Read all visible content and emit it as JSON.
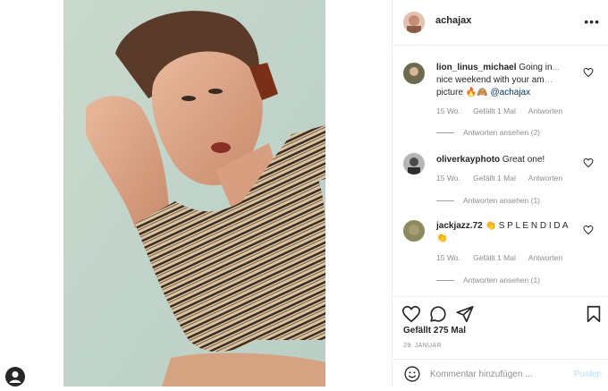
{
  "post": {
    "username": "achajax",
    "likes": "Gefällt 275 Mal",
    "date": "29. JANUAR"
  },
  "comments": [
    {
      "username": "lion_linus_michael",
      "text_a": "Going in",
      "text_b": "nice weekend with your am",
      "text_c": "picture",
      "emojis": "🔥🙈",
      "mention": "@achajax",
      "age": "15 Wo.",
      "likes": "Gefällt 1 Mal",
      "reply": "Antworten",
      "view_replies": "Antworten ansehen (2)"
    },
    {
      "username": "oliverkayphoto",
      "text": "Great one!",
      "age": "15 Wo.",
      "likes": "Gefällt 1 Mal",
      "reply": "Antworten",
      "view_replies": "Antworten ansehen (1)"
    },
    {
      "username": "jackjazz.72",
      "text": "👏 S P L E N D I D A 👏",
      "age": "15 Wo.",
      "likes": "Gefällt 1 Mal",
      "reply": "Antworten",
      "view_replies": "Antworten ansehen (1)"
    }
  ],
  "add_comment": {
    "placeholder": "Kommentar hinzufügen ...",
    "post_label": "Posten"
  },
  "icons": {
    "more": "more-icon",
    "like": "heart-icon",
    "comment": "comment-icon",
    "share": "share-icon",
    "save": "bookmark-icon",
    "emoji": "smiley-icon",
    "profile": "user-icon"
  },
  "colors": {
    "text": "#262626",
    "muted": "#8e8e8e",
    "link": "#00376b",
    "post_button": "#b2dffc",
    "divider": "#efefef"
  }
}
